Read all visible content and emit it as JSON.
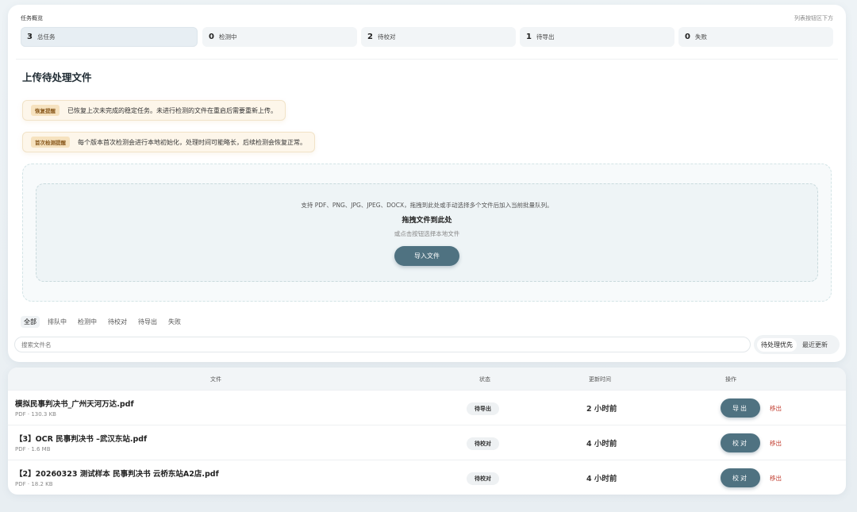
{
  "overview": {
    "title": "任务概览",
    "hint": "列表按钮区下方",
    "stats": [
      {
        "num": "3",
        "label": "总任务"
      },
      {
        "num": "0",
        "label": "检测中"
      },
      {
        "num": "2",
        "label": "待校对"
      },
      {
        "num": "1",
        "label": "待导出"
      },
      {
        "num": "0",
        "label": "失败"
      }
    ]
  },
  "upload": {
    "title": "上传待处理文件",
    "notices": [
      {
        "tag": "恢复提醒",
        "msg": "已恢复上次未完成的稳定任务。未进行检测的文件在重启后需要重新上传。"
      },
      {
        "tag": "首次检测提醒",
        "msg": "每个版本首次检测会进行本地初始化，处理时间可能略长，后续检测会恢复正常。"
      }
    ],
    "drop_desc": "支持 PDF、PNG、JPG、JPEG、DOCX，拖拽到此处或手动选择多个文件后加入当前批量队列。",
    "drop_main": "拖拽文件到此处",
    "drop_sub": "或点击按钮选择本地文件",
    "import_label": "导入文件"
  },
  "filters": [
    "全部",
    "排队中",
    "检测中",
    "待校对",
    "待导出",
    "失败"
  ],
  "search": {
    "placeholder": "搜索文件名"
  },
  "sort": {
    "priority": "待处理优先",
    "recent": "最近更新"
  },
  "table": {
    "headers": {
      "file": "文件",
      "status": "状态",
      "time": "更新时间",
      "action": "操作"
    },
    "rows": [
      {
        "name": "模拟民事判决书_广州天河万达.pdf",
        "meta": "PDF · 130.3 KB",
        "status": "待导出",
        "time": "2 小时前",
        "action": "导出",
        "remove": "移出"
      },
      {
        "name": "【3】OCR 民事判决书 –武汉东站.pdf",
        "meta": "PDF · 1.6 MB",
        "status": "待校对",
        "time": "4 小时前",
        "action": "校对",
        "remove": "移出"
      },
      {
        "name": "【2】20260323 测试样本 民事判决书 云桥东站A2店.pdf",
        "meta": "PDF · 18.2 KB",
        "status": "待校对",
        "time": "4 小时前",
        "action": "校对",
        "remove": "移出"
      }
    ]
  }
}
